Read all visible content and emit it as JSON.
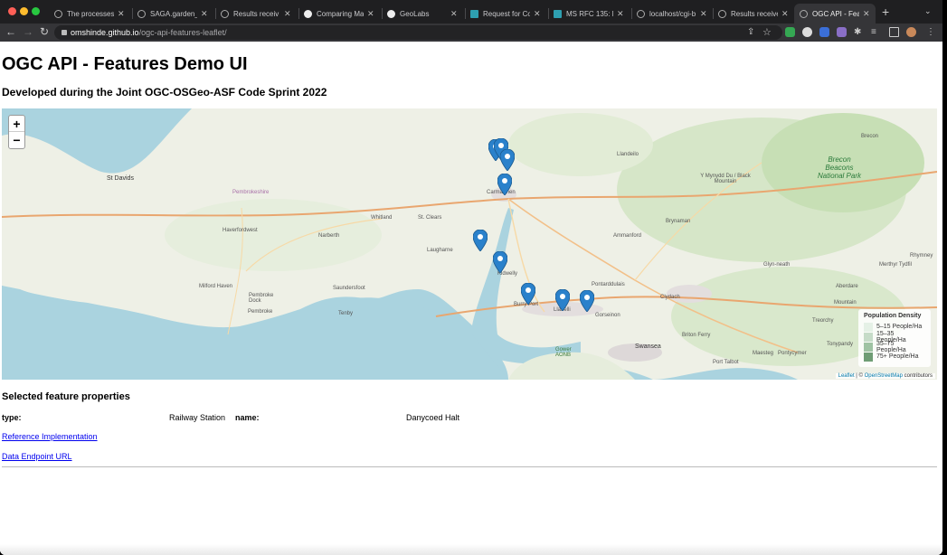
{
  "browser": {
    "tabs": [
      {
        "title": "The processes"
      },
      {
        "title": "SAGA.garden_"
      },
      {
        "title": "Results receiv"
      },
      {
        "title": "Comparing Ma"
      },
      {
        "title": "GeoLabs"
      },
      {
        "title": "Request for Co"
      },
      {
        "title": "MS RFC 135: M"
      },
      {
        "title": "localhost/cgi-b"
      },
      {
        "title": "Results receive"
      },
      {
        "title": "OGC API - Feat"
      }
    ],
    "url_host": "omshinde.github.io",
    "url_path": "/ogc-api-features-leaflet/"
  },
  "page": {
    "title": "OGC API - Features Demo UI",
    "subtitle": "Developed during the Joint OGC-OSGeo-ASF Code Sprint 2022"
  },
  "map": {
    "zoom_in": "+",
    "zoom_out": "−",
    "legend": {
      "title": "Population Density",
      "items": [
        {
          "label": "5–15 People/Ha",
          "color": "#e5f1e6"
        },
        {
          "label": "15–35 People/Ha",
          "color": "#c6dcc8"
        },
        {
          "label": "35–75 People/Ha",
          "color": "#9fc3a3"
        },
        {
          "label": "75+ People/Ha",
          "color": "#6f9d75"
        }
      ]
    },
    "attribution_leaflet": "Leaflet",
    "attribution_sep": " | © ",
    "attribution_osm": "OpenStreetMap",
    "attribution_tail": " contributors",
    "places": {
      "st_davids": "St Davids",
      "pembrokeshire": "Pembrokeshire",
      "haverfordwest": "Haverfordwest",
      "narberth": "Narberth",
      "whitland": "Whitland",
      "st_clears": "St. Clears",
      "carmarthen": "Carmarthen",
      "llandeilo": "Llandeilo",
      "brecon": "Brecon",
      "brecon_beacons": "Brecon Beacons National Park",
      "mynydd": "Y Mynydd Du / Black Mountain",
      "laugharne": "Laugharne",
      "kidwelly": "Kidwelly",
      "ammanford": "Ammanford",
      "brynaman": "Brynaman",
      "milford_haven": "Milford Haven",
      "pembroke_dock": "Pembroke Dock",
      "pembroke": "Pembroke",
      "saundersfoot": "Saundersfoot",
      "tenby": "Tenby",
      "burry_port": "Burry Port",
      "llanelli": "Llanelli",
      "gorseinon": "Gorseinon",
      "swansea": "Swansea",
      "pontarddulais": "Pontarddulais",
      "clydach": "Clydach",
      "gower": "Gower AONB",
      "neath": "Glyn-neath",
      "merthyr": "Merthyr Tydfil",
      "aberdare": "Aberdare",
      "treorchy": "Treorchy",
      "tonypandy": "Tonypandy",
      "maesteg": "Maesteg",
      "port_talbot": "Port Talbot",
      "briton_ferry": "Briton Ferry",
      "pontycymer": "Pontycymer",
      "rhymney": "Rhymney",
      "mountain": "Mountain"
    }
  },
  "selected": {
    "heading": "Selected feature properties",
    "type_label": "type:",
    "type_value": "Railway Station",
    "name_label": "name:",
    "name_value": "Danycoed Halt"
  },
  "links": {
    "reference": "Reference Implementation",
    "endpoint": "Data Endpoint URL"
  }
}
